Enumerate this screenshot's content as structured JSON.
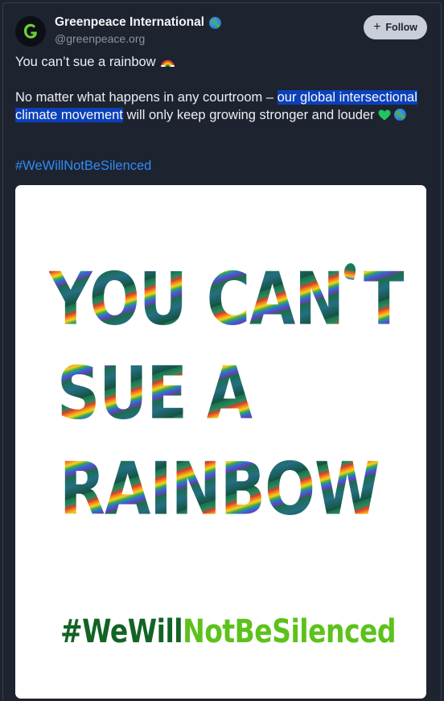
{
  "post": {
    "author_name": "Greenpeace International",
    "author_handle": "@greenpeace.org",
    "follow_label": "Follow",
    "line1": "You can’t sue a rainbow",
    "para_before": "No matter what happens in any courtroom – ",
    "para_highlight": "our global intersectional climate movement",
    "para_after": " will  only keep growing stronger and louder",
    "hashtag": "#WeWillNotBeSilenced",
    "emoji": [
      "rainbow-icon",
      "green-heart-icon",
      "globe-icon"
    ]
  },
  "image": {
    "line1": "YOU CAN T",
    "line2": "SUE A",
    "line3": "RAINBOW",
    "tag_part1": "#WeWill",
    "tag_part2": "NotBeSilenced"
  },
  "colors": {
    "background": "#1e2330",
    "highlight": "#0b40b9",
    "link": "#2f8cf5",
    "follow_button": "#c9ced8",
    "tag_dark_green": "#136326",
    "tag_light_green": "#5cc21a"
  }
}
